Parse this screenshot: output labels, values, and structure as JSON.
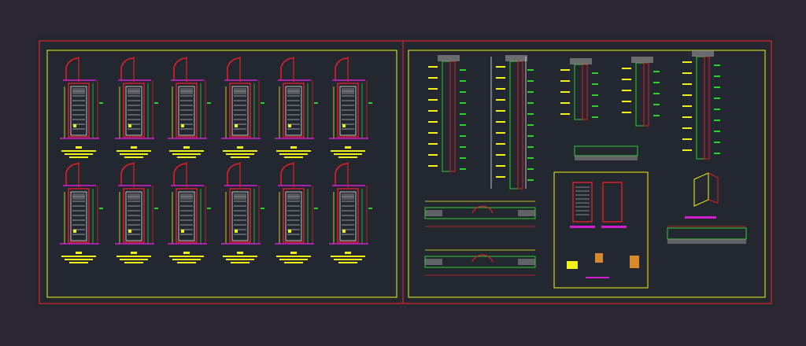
{
  "app": {
    "canvas_background": "#2b2631",
    "sheet_background": "#232730"
  },
  "colors": {
    "sheet_border": "#e01f26",
    "frame": "#f2f218",
    "door_red": "#e01f26",
    "dim_green": "#2bd02b",
    "hatch_white": "#e6e6e6",
    "accent_magenta": "#d11ed1",
    "accent_cyan": "#27c8e6",
    "label_yellow": "#f2f218"
  },
  "left_panel": {
    "name": "door-elevations-sheet",
    "doors_top_row": 6,
    "doors_bottom_row": 6
  },
  "right_panel": {
    "name": "door-details-sheet",
    "details": [
      "wall-section-1",
      "wall-section-2",
      "jamb-detail",
      "head-detail",
      "corner-detail",
      "floor-plan-detail-1",
      "floor-plan-detail-2",
      "inset-detail-box",
      "isometric-hardware"
    ]
  },
  "icons": {
    "door_swing": "door-swing-arc-icon"
  }
}
